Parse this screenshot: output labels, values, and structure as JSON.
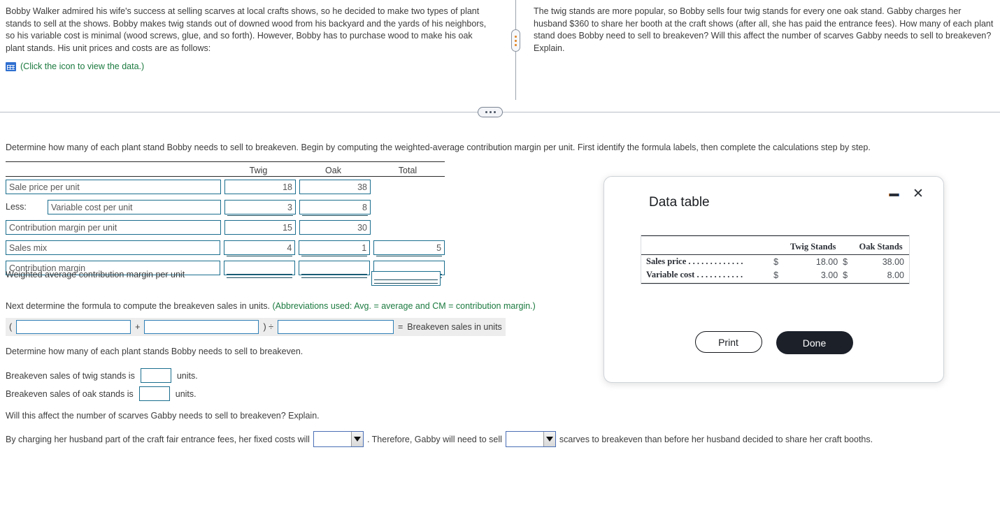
{
  "problem": {
    "left_text": "Bobby Walker admired his wife's success at selling scarves at local crafts shows, so he decided to make two types of plant stands to sell at the shows. Bobby makes twig stands out of downed wood from his backyard and the yards of his neighbors, so his variable cost is minimal (wood screws, glue, and so forth). However, Bobby has to purchase wood to make his oak plant stands. His unit prices and costs are as follows:",
    "data_link": "(Click the icon to view the data.)",
    "right_text": "The twig stands are more popular, so Bobby sells four twig stands for every one oak stand. Gabby charges her husband $360 to share her booth at the craft shows (after all, she has paid the entrance fees). How many of each plant stand does Bobby need to sell to breakeven? Will this affect the number of scarves Gabby needs to sell to breakeven? Explain."
  },
  "work": {
    "instruction1": "Determine how many of each plant stand Bobby needs to sell to breakeven. Begin by computing the weighted-average contribution margin per unit. First identify the formula labels, then complete the calculations step by step.",
    "columns": [
      "Twig",
      "Oak",
      "Total"
    ],
    "rows": [
      {
        "label": "Sale price per unit",
        "prefix": "",
        "twig": "18",
        "oak": "38",
        "total": ""
      },
      {
        "label": "Variable cost per unit",
        "prefix": "Less:",
        "twig": "3",
        "oak": "8",
        "total": ""
      },
      {
        "label": "Contribution margin per unit",
        "prefix": "",
        "twig": "15",
        "oak": "30",
        "total": ""
      },
      {
        "label": "Sales mix",
        "prefix": "",
        "twig": "4",
        "oak": "1",
        "total": "5"
      },
      {
        "label": "Contribution margin",
        "prefix": "",
        "twig": "",
        "oak": "",
        "total": ""
      }
    ],
    "weighted_avg_label": "Weighted average contribution margin per unit",
    "weighted_avg_value": "",
    "instruction2_plain": "Next determine the formula to compute the breakeven sales in units. ",
    "instruction2_green": "(Abbreviations used: Avg. = average and CM = contribution margin.)",
    "formula": {
      "open_paren": "(",
      "input1": "",
      "plus": "+",
      "input2": "",
      "close_divide": ") ÷",
      "input3": "",
      "equals": "=",
      "result_label": "Breakeven sales in units"
    },
    "instruction3": "Determine how many of each plant stands Bobby needs to sell to breakeven.",
    "answers": [
      {
        "label": "Breakeven sales of twig stands is",
        "value": "",
        "unit": "units."
      },
      {
        "label": "Breakeven sales of oak stands is",
        "value": "",
        "unit": "units."
      }
    ],
    "instruction4": "Will this affect the number of scarves Gabby needs to sell to breakeven? Explain.",
    "conclusion": {
      "part1": "By charging her husband part of the craft fair entrance fees, her fixed costs will",
      "dropdown1_value": "",
      "part2": ". Therefore, Gabby will need to sell",
      "dropdown2_value": "",
      "part3": "scarves to breakeven than before her husband decided to share her craft booths."
    }
  },
  "modal": {
    "title": "Data table",
    "table": {
      "col_headers": [
        "Twig Stands",
        "Oak Stands"
      ],
      "rows": [
        {
          "name": "Sales price . . . . . . . . . . . . .",
          "twig_currency": "$",
          "twig": "18.00",
          "oak_currency": "$",
          "oak": "38.00"
        },
        {
          "name": "Variable cost . . . . . . . . . . .",
          "twig_currency": "$",
          "twig": "3.00",
          "oak_currency": "$",
          "oak": "8.00"
        }
      ]
    },
    "print_label": "Print",
    "done_label": "Done"
  },
  "colors": {
    "link_green": "#1b7a3f",
    "input_border": "#1a6e8e",
    "accent_blue": "#2f6fd0",
    "modal_dark": "#1b2029"
  }
}
